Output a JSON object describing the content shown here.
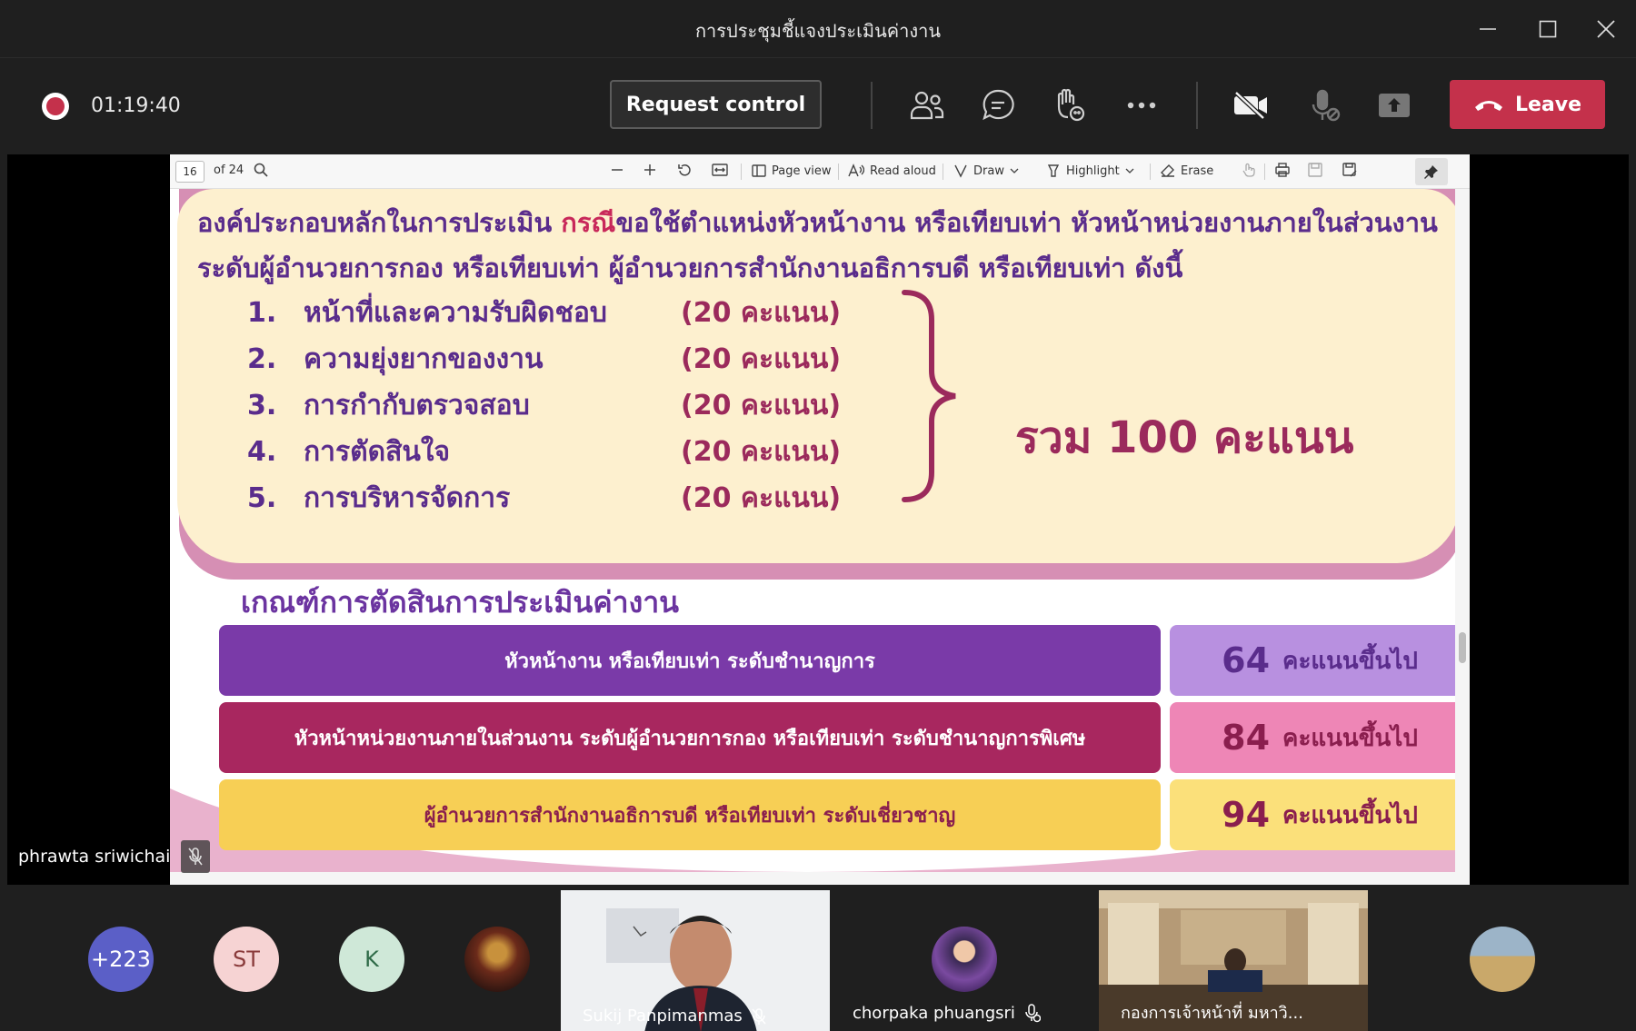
{
  "window": {
    "title": "การประชุมชี้แจงประเมินค่างาน"
  },
  "toolbar": {
    "timer": "01:19:40",
    "request_control_label": "Request control",
    "leave_label": "Leave",
    "colors": {
      "leave": "#c4314b",
      "recording": "#c4314b"
    }
  },
  "pdf": {
    "page_number": "16",
    "page_total": "of 24",
    "tools": {
      "page_view": "Page view",
      "read_aloud": "Read aloud",
      "draw": "Draw",
      "highlight": "Highlight",
      "erase": "Erase"
    }
  },
  "slide": {
    "intro_part1": "องค์ประกอบหลักในการประเมิน ",
    "intro_red": "กรณี",
    "intro_part2": "ขอใช้ตำแหน่งหัวหน้างาน หรือเทียบเท่า หัวหน้าหน่วยงานภายในส่วนงาน ระดับผู้อำนวยการกอง หรือเทียบเท่า ผู้อำนวยการสำนักงานอธิการบดี หรือเทียบเท่า ดังนี้",
    "criteria": [
      {
        "num": "1.",
        "label": "หน้าที่และความรับผิดชอบ",
        "score": "(20 คะแนน)"
      },
      {
        "num": "2.",
        "label": "ความยุ่งยากของงาน",
        "score": "(20 คะแนน)"
      },
      {
        "num": "3.",
        "label": "การกำกับตรวจสอบ",
        "score": "(20 คะแนน)"
      },
      {
        "num": "4.",
        "label": "การตัดสินใจ",
        "score": "(20 คะแนน)"
      },
      {
        "num": "5.",
        "label": "การบริหารจัดการ",
        "score": "(20 คะแนน)"
      }
    ],
    "total": "รวม 100 คะแนน",
    "decision_title": "เกณฑ์การตัดสินการประเมินค่างาน",
    "levels": [
      {
        "position": "หัวหน้างาน หรือเทียบเท่า ระดับชำนาญการ",
        "score": "64",
        "suffix": "คะแนนขึ้นไป",
        "left_color": "#7a3aa8",
        "right_color": "#b890e0",
        "text_color": "#5a2c8c"
      },
      {
        "position": "หัวหน้าหน่วยงานภายในส่วนงาน ระดับผู้อำนวยการกอง หรือเทียบเท่า ระดับชำนาญการพิเศษ",
        "score": "84",
        "suffix": "คะแนนขึ้นไป",
        "left_color": "#a8275f",
        "right_color": "#ee86b6",
        "text_color": "#8a1e4e"
      },
      {
        "position": "ผู้อำนวยการสำนักงานอธิการบดี หรือเทียบเท่า ระดับเชี่ยวชาญ",
        "score": "94",
        "suffix": "คะแนนขึ้นไป",
        "left_color": "#f7cf55",
        "right_color": "#fbe07a",
        "text_color": "#8a1e4e"
      }
    ]
  },
  "presenter": {
    "name": "phrawta sriwichai"
  },
  "participants": {
    "overflow": "+223",
    "st": "ST",
    "k": "K",
    "tile1_name": "Sukij Panpimanmas",
    "tile2_name": "chorpaka phuangsri",
    "tile3_name": "กองการเจ้าหน้าที่ มหาวิ..."
  }
}
